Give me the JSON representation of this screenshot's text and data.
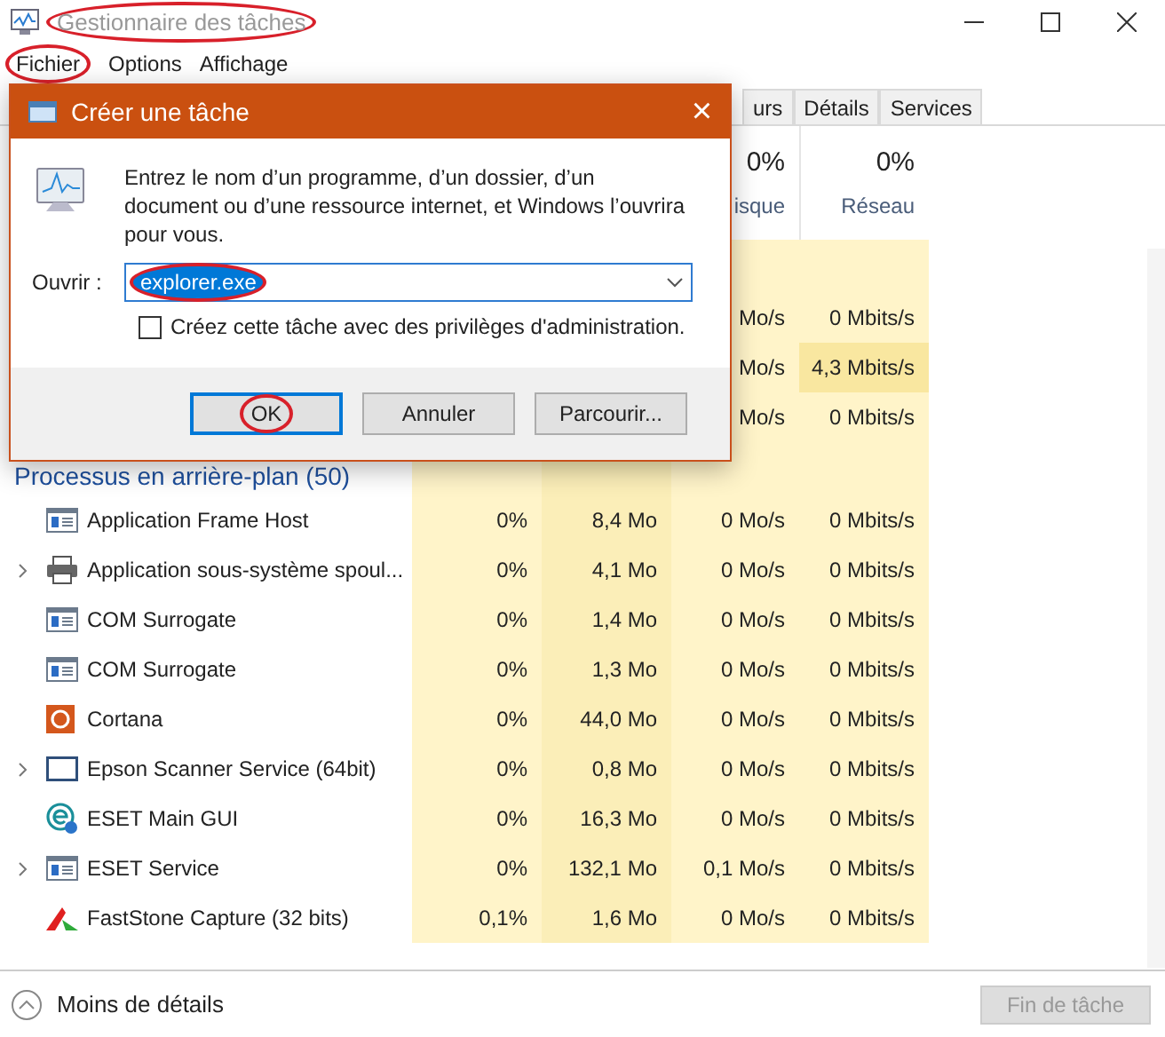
{
  "window": {
    "title": "Gestionnaire des tâches",
    "title_circled": true
  },
  "menu": [
    {
      "label": "Fichier",
      "circled": true
    },
    {
      "label": "Options",
      "circled": false
    },
    {
      "label": "Affichage",
      "circled": false
    }
  ],
  "tabs": [
    {
      "label": "urs",
      "selected": false
    },
    {
      "label": "Détails",
      "selected": false
    },
    {
      "label": "Services",
      "selected": false
    }
  ],
  "columns": [
    {
      "percent": "0%",
      "label": "isque"
    },
    {
      "percent": "0%",
      "label": "Réseau"
    }
  ],
  "app_rows": [
    {
      "disk": "Mo/s",
      "network": "0 Mbits/s"
    },
    {
      "disk": "Mo/s",
      "network": "4,3 Mbits/s"
    },
    {
      "disk": "Mo/s",
      "network": "0 Mbits/s"
    }
  ],
  "section": "Processus en arrière-plan (50)",
  "rows": [
    {
      "kind": "window",
      "expandable": false,
      "name": "Application Frame Host",
      "cpu": "0%",
      "memory": "8,4 Mo",
      "disk": "0 Mo/s",
      "network": "0 Mbits/s"
    },
    {
      "kind": "printer",
      "expandable": true,
      "name": "Application sous-système spoul...",
      "cpu": "0%",
      "memory": "4,1 Mo",
      "disk": "0 Mo/s",
      "network": "0 Mbits/s"
    },
    {
      "kind": "window",
      "expandable": false,
      "name": "COM Surrogate",
      "cpu": "0%",
      "memory": "1,4 Mo",
      "disk": "0 Mo/s",
      "network": "0 Mbits/s"
    },
    {
      "kind": "window",
      "expandable": false,
      "name": "COM Surrogate",
      "cpu": "0%",
      "memory": "1,3 Mo",
      "disk": "0 Mo/s",
      "network": "0 Mbits/s"
    },
    {
      "kind": "cortana",
      "expandable": false,
      "name": "Cortana",
      "cpu": "0%",
      "memory": "44,0 Mo",
      "disk": "0 Mo/s",
      "network": "0 Mbits/s"
    },
    {
      "kind": "frame",
      "expandable": true,
      "name": "Epson Scanner Service (64bit)",
      "cpu": "0%",
      "memory": "0,8 Mo",
      "disk": "0 Mo/s",
      "network": "0 Mbits/s"
    },
    {
      "kind": "eset",
      "expandable": false,
      "name": "ESET Main GUI",
      "cpu": "0%",
      "memory": "16,3 Mo",
      "disk": "0 Mo/s",
      "network": "0 Mbits/s"
    },
    {
      "kind": "window",
      "expandable": true,
      "name": "ESET Service",
      "cpu": "0%",
      "memory": "132,1 Mo",
      "disk": "0,1 Mo/s",
      "network": "0 Mbits/s"
    },
    {
      "kind": "capture",
      "expandable": false,
      "name": "FastStone Capture (32 bits)",
      "cpu": "0,1%",
      "memory": "1,6 Mo",
      "disk": "0 Mo/s",
      "network": "0 Mbits/s"
    }
  ],
  "footer": {
    "details_link": "Moins de détails",
    "end_task": {
      "label": "Fin de tâche",
      "disabled": true
    }
  },
  "dialog": {
    "title": "Créer une tâche",
    "close": "×",
    "description": "Entrez le nom d’un programme, d’un dossier, d’un document ou d’une ressource internet, et Windows l’ouvrira pour vous.",
    "open_label": "Ouvrir :",
    "value": "explorer.exe",
    "value_circled": true,
    "checkbox": {
      "label": "Créez cette tâche avec des privilèges d'administration.",
      "checked": false
    },
    "buttons": [
      {
        "label": "OK",
        "default": true,
        "circled": true
      },
      {
        "label": "Annuler",
        "default": false,
        "circled": false
      },
      {
        "label": "Parcourir...",
        "default": false,
        "circled": false
      }
    ]
  }
}
